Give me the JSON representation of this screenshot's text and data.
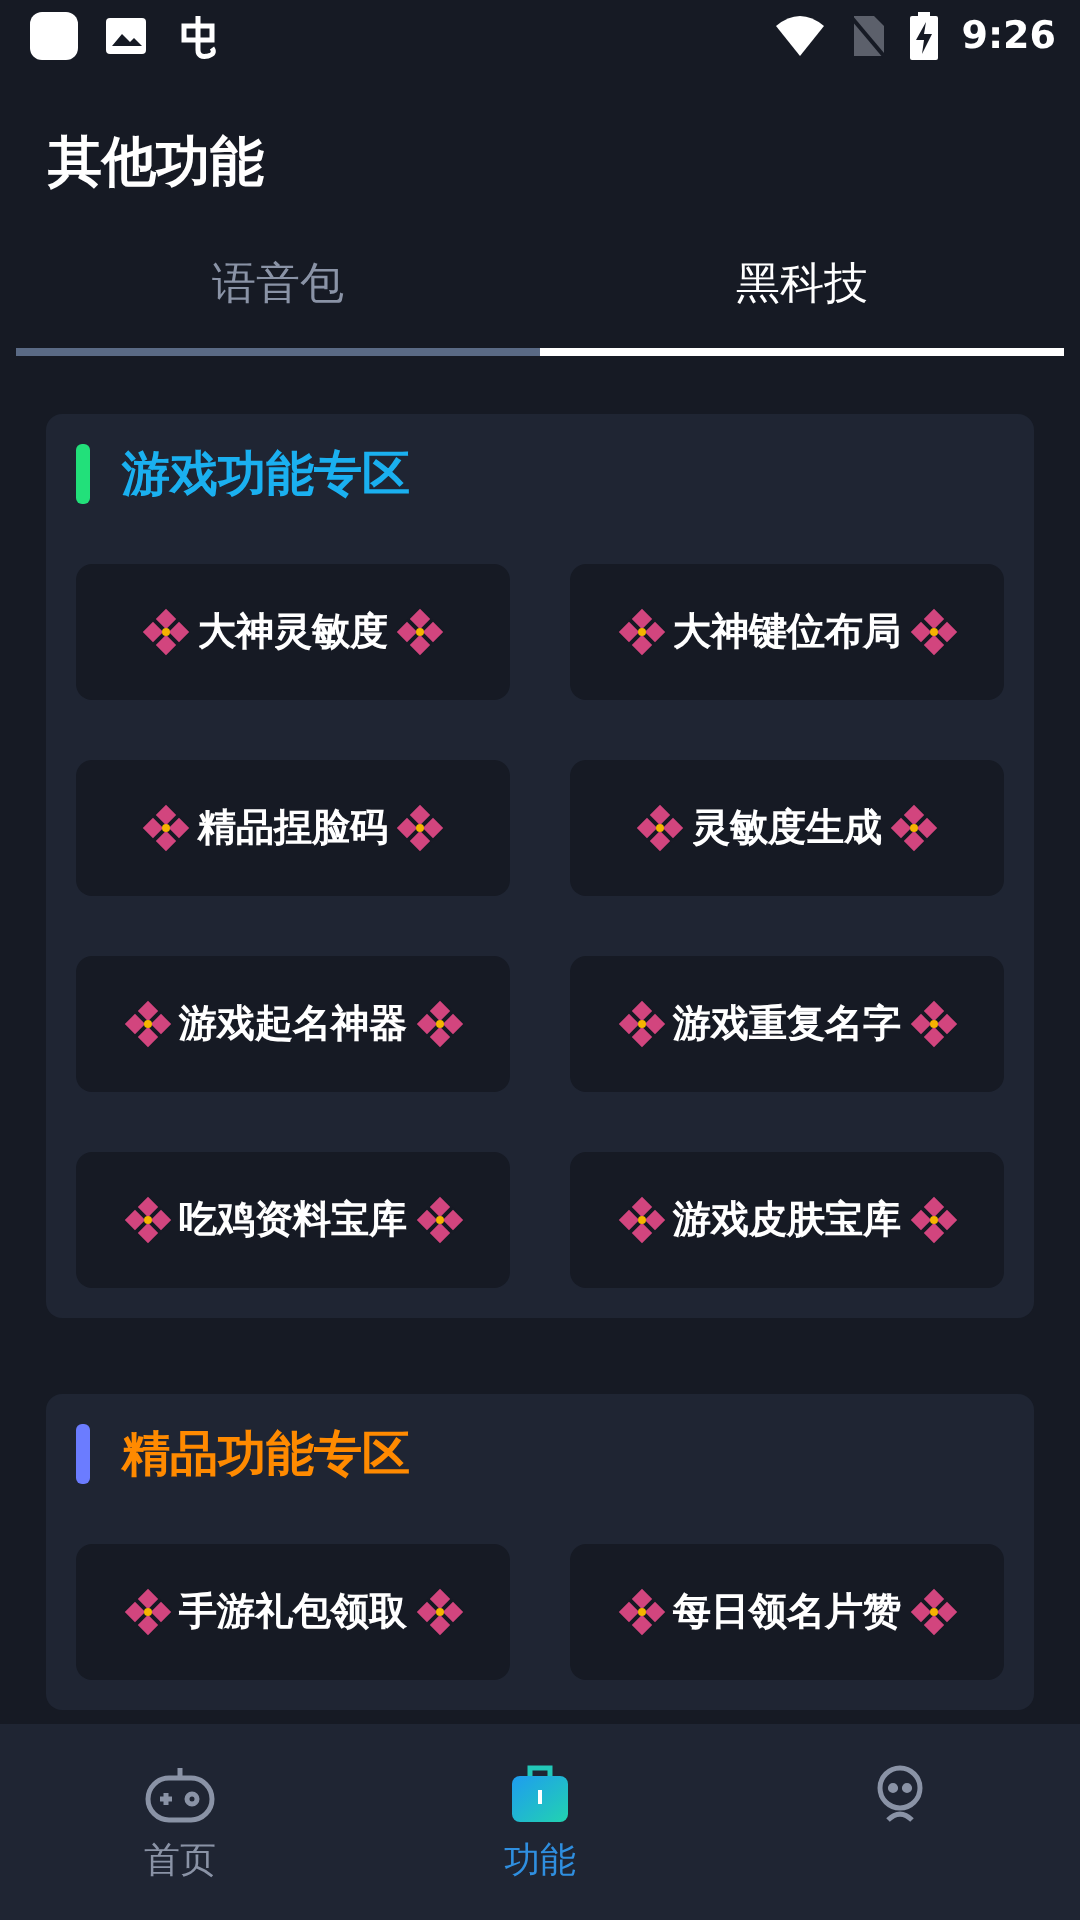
{
  "status_bar": {
    "time": "9:26"
  },
  "header": {
    "title": "其他功能"
  },
  "tabs": [
    {
      "label": "语音包",
      "selected": false
    },
    {
      "label": "黑科技",
      "selected": true
    }
  ],
  "sections": [
    {
      "title": {
        "text": "游戏功能专区",
        "color": "#1ab0f0"
      },
      "accent": {
        "color": "#22e07a"
      },
      "items": [
        "大神灵敏度",
        "大神键位布局",
        "精品捏脸码",
        "灵敏度生成",
        "游戏起名神器",
        "游戏重复名字",
        "吃鸡资料宝库",
        "游戏皮肤宝库"
      ]
    },
    {
      "title": {
        "text": "精品功能专区",
        "color": "#ff8a00"
      },
      "accent": {
        "color": "#6b7cff"
      },
      "items": [
        "手游礼包领取",
        "每日领名片赞"
      ]
    }
  ],
  "nav": [
    {
      "kind": "gamepad",
      "label": "首页",
      "selected": false
    },
    {
      "kind": "briefcase",
      "label": "功能",
      "selected": true
    },
    {
      "kind": "robot",
      "selected": false
    }
  ]
}
